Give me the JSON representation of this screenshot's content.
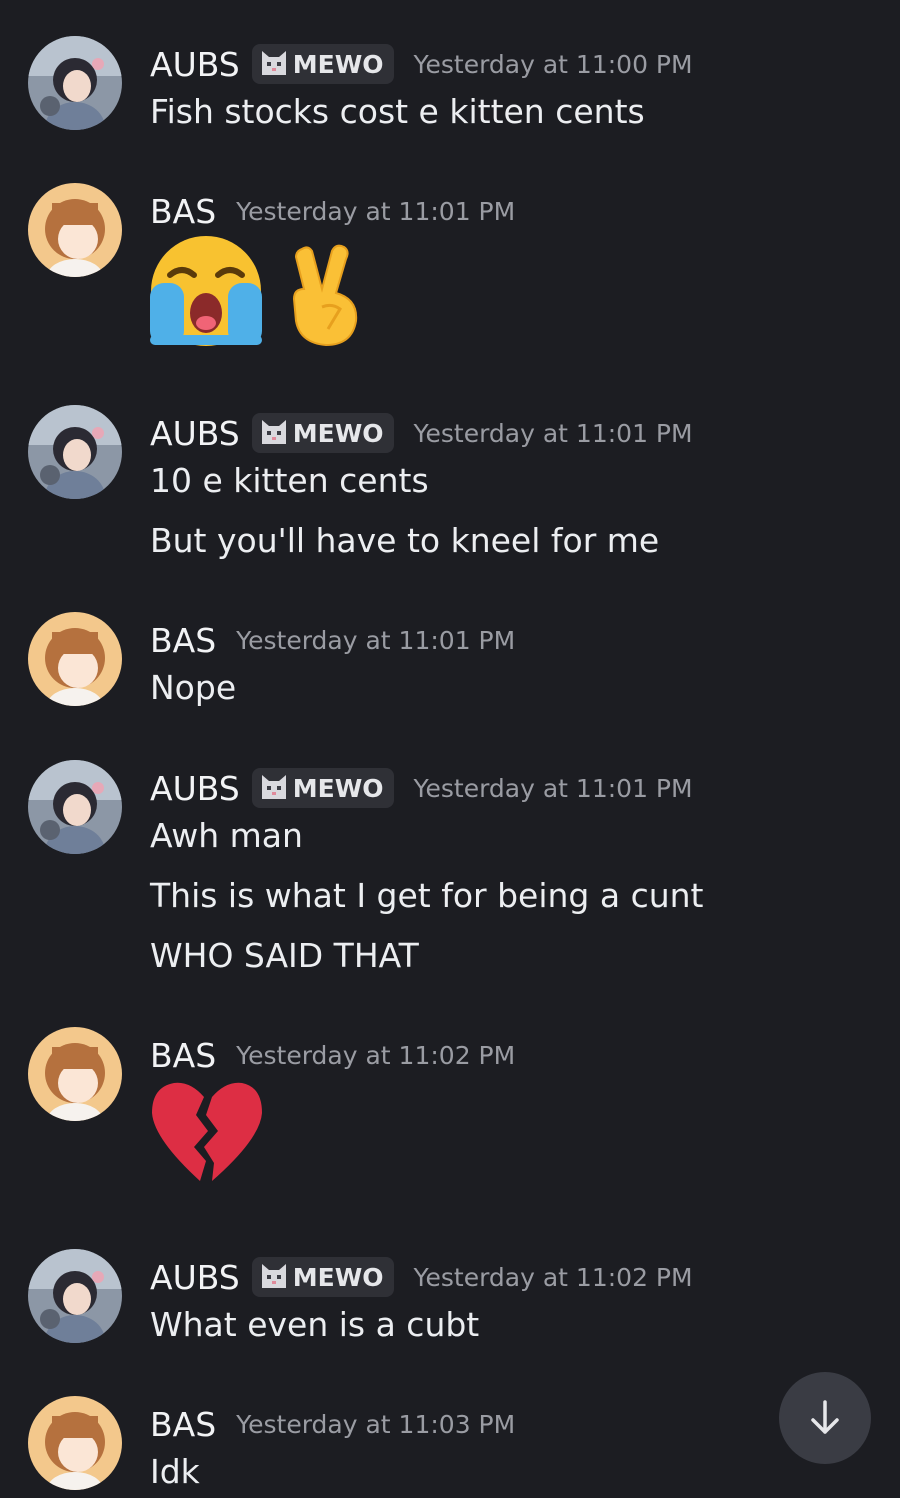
{
  "messages": [
    {
      "username": "AUBS",
      "tag": "MEWO",
      "timestamp": "Yesterday at 11:00 PM",
      "avatar": "aubs-avatar",
      "lines": [
        "Fish stocks cost e kitten cents"
      ]
    },
    {
      "username": "BAS",
      "timestamp": "Yesterday at 11:01 PM",
      "avatar": "bas-avatar",
      "emojis": [
        "loudly-crying-face-emoji",
        "victory-hand-emoji"
      ]
    },
    {
      "username": "AUBS",
      "tag": "MEWO",
      "timestamp": "Yesterday at 11:01 PM",
      "avatar": "aubs-avatar",
      "lines": [
        "10 e kitten cents",
        "But you'll have to kneel for me"
      ]
    },
    {
      "username": "BAS",
      "timestamp": "Yesterday at 11:01 PM",
      "avatar": "bas-avatar",
      "lines": [
        "Nope"
      ]
    },
    {
      "username": "AUBS",
      "tag": "MEWO",
      "timestamp": "Yesterday at 11:01 PM",
      "avatar": "aubs-avatar",
      "lines": [
        "Awh man",
        "This is what I get for being a cunt",
        "WHO SAID THAT"
      ]
    },
    {
      "username": "BAS",
      "timestamp": "Yesterday at 11:02 PM",
      "avatar": "bas-avatar",
      "emojis": [
        "broken-heart-emoji"
      ]
    },
    {
      "username": "AUBS",
      "tag": "MEWO",
      "timestamp": "Yesterday at 11:02 PM",
      "avatar": "aubs-avatar",
      "lines": [
        "What even is a cubt"
      ]
    },
    {
      "username": "BAS",
      "timestamp": "Yesterday at 11:03 PM",
      "avatar": "bas-avatar",
      "lines": [
        "Idk"
      ]
    }
  ],
  "scroll_button": {
    "icon": "arrow-down-icon"
  },
  "colors": {
    "background": "#1c1d22",
    "text": "#f2f3f5",
    "timestamp": "#9a9ca3",
    "tag_background": "#2f3036"
  }
}
